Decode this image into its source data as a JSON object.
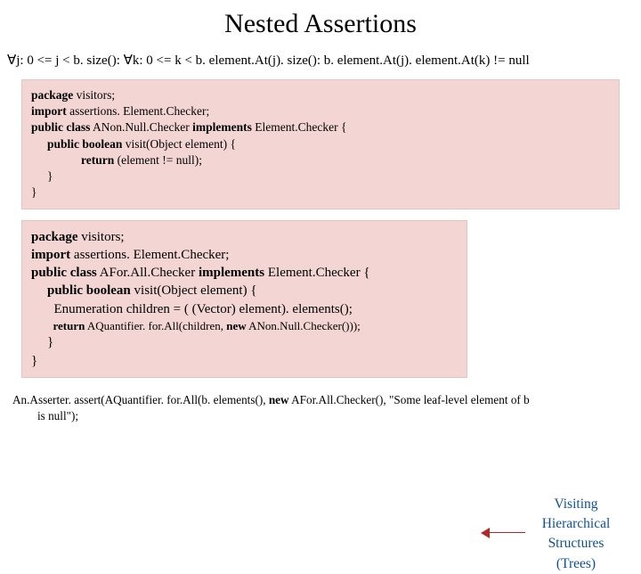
{
  "title": "Nested Assertions",
  "formula": "∀j: 0 <= j < b. size(): ∀k: 0 <= k <  b. element.At(j). size(): b. element.At(j). element.At(k) != null",
  "code1": {
    "l1a": "package",
    "l1b": " visitors;",
    "l2a": "import",
    "l2b": " assertions. Element.Checker;",
    "l3a": "public class",
    "l3b": " ANon.Null.Checker ",
    "l3c": "implements",
    "l3d": " Element.Checker {",
    "l4a": "public boolean",
    "l4b": " visit(Object element) {",
    "l5a": "return",
    "l5b": " (element != null);",
    "l6": "}",
    "l7": "}"
  },
  "code2": {
    "l1a": "package",
    "l1b": " visitors;",
    "l2a": "import",
    "l2b": " assertions. Element.Checker;",
    "l3a": "public class",
    "l3b": " AFor.All.Checker ",
    "l3c": "implements",
    "l3d": " Element.Checker {",
    "l4a": "public boolean",
    "l4b": " visit(Object element) {",
    "l5": "Enumeration children = ( (Vector) element). elements();",
    "l6a": "return",
    "l6b": " AQuantifier. for.All(children, ",
    "l6c": "new",
    "l6d": " ANon.Null.Checker()));",
    "l7": "}",
    "l8": "}"
  },
  "note": {
    "l1": "Visiting",
    "l2": "Hierarchical",
    "l3": "Structures",
    "l4": "(Trees)"
  },
  "bottom": {
    "part1": "An.Asserter. assert(AQuantifier. for.All(b. elements(), ",
    "kw": "new",
    "part2": " AFor.All.Checker(), \"Some leaf-level element of b",
    "cont": "is null\");"
  }
}
